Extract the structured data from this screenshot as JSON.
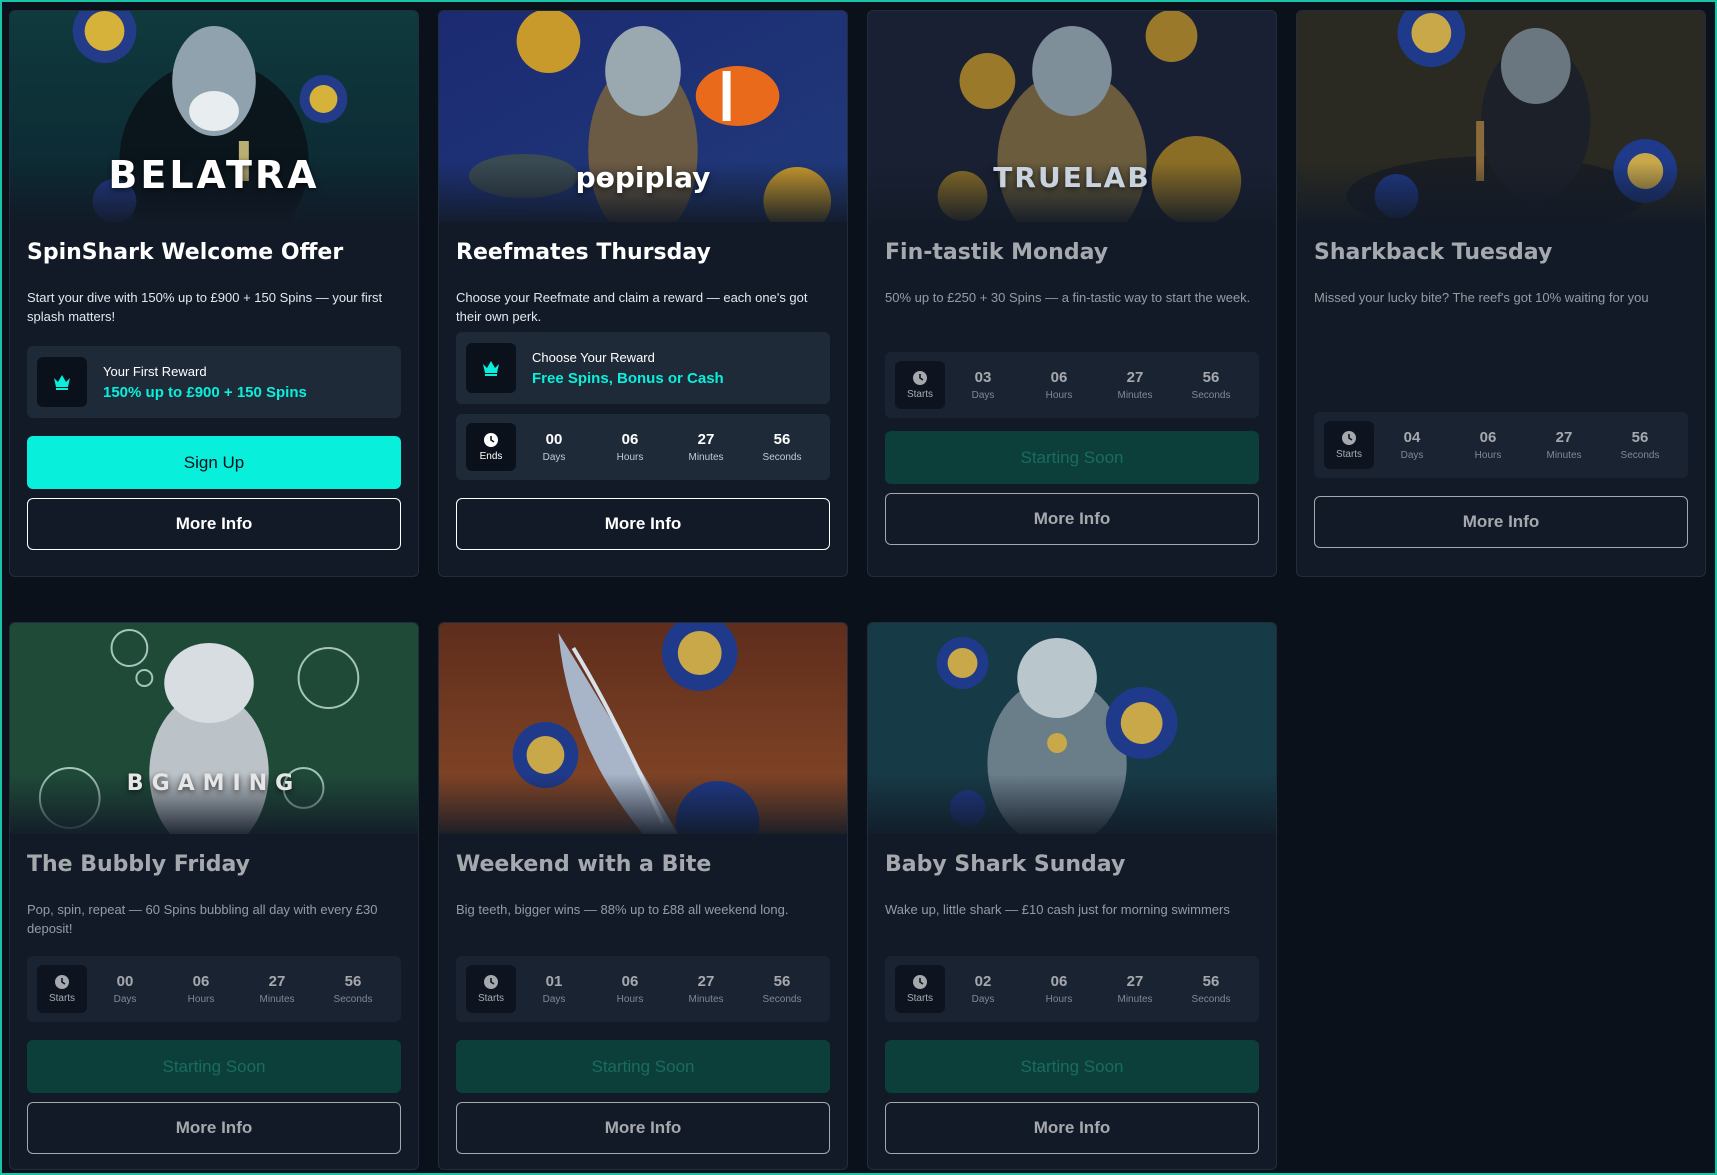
{
  "colors": {
    "accent": "#08f0dc",
    "background": "#0b111b",
    "card": "#121a27",
    "panel": "#1f2a39",
    "starting_soon_bg": "#0c3f3a"
  },
  "cards": [
    {
      "brand": "BELATRA",
      "title": "SpinShark Welcome Offer",
      "description": "Start your dive with 150% up to £900 + 150 Spins — your first splash matters!",
      "reward": {
        "icon": "crown-icon",
        "label": "Your First Reward",
        "value": "150% up to £900 + 150 Spins"
      },
      "primary_button": "Sign Up",
      "more_button": "More Info"
    },
    {
      "brand": "pɵpiplay",
      "title": "Reefmates Thursday",
      "description": "Choose your Reefmate and claim a reward — each one's got their own perk.",
      "reward": {
        "icon": "crown-icon",
        "label": "Choose Your Reward",
        "value": "Free Spins, Bonus or Cash"
      },
      "countdown": {
        "label": "Ends",
        "days": "00",
        "hours": "06",
        "minutes": "27",
        "seconds": "56"
      },
      "more_button": "More Info"
    },
    {
      "brand": "TRUELAB",
      "title": "Fin-tastik Monday",
      "description": "50% up to £250 + 30 Spins — a fin-tastic way to start the week.",
      "countdown": {
        "label": "Starts",
        "days": "03",
        "hours": "06",
        "minutes": "27",
        "seconds": "56"
      },
      "primary_button": "Starting Soon",
      "more_button": "More Info"
    },
    {
      "title": "Sharkback Tuesday",
      "description": "Missed your lucky bite? The reef's got 10% waiting for you",
      "countdown": {
        "label": "Starts",
        "days": "04",
        "hours": "06",
        "minutes": "27",
        "seconds": "56"
      },
      "more_button": "More Info"
    },
    {
      "brand": "BGAMING",
      "title": "The Bubbly Friday",
      "description": "Pop, spin, repeat — 60 Spins bubbling all day with every £30 deposit!",
      "countdown": {
        "label": "Starts",
        "days": "00",
        "hours": "06",
        "minutes": "27",
        "seconds": "56"
      },
      "primary_button": "Starting Soon",
      "more_button": "More Info"
    },
    {
      "title": "Weekend with a Bite",
      "description": "Big teeth, bigger wins — 88% up to £88 all weekend long.",
      "countdown": {
        "label": "Starts",
        "days": "01",
        "hours": "06",
        "minutes": "27",
        "seconds": "56"
      },
      "primary_button": "Starting Soon",
      "more_button": "More Info"
    },
    {
      "title": "Baby Shark Sunday",
      "description": "Wake up, little shark — £10 cash just for morning swimmers",
      "countdown": {
        "label": "Starts",
        "days": "02",
        "hours": "06",
        "minutes": "27",
        "seconds": "56"
      },
      "primary_button": "Starting Soon",
      "more_button": "More Info"
    }
  ],
  "unit_labels": {
    "days": "Days",
    "hours": "Hours",
    "minutes": "Minutes",
    "seconds": "Seconds"
  }
}
